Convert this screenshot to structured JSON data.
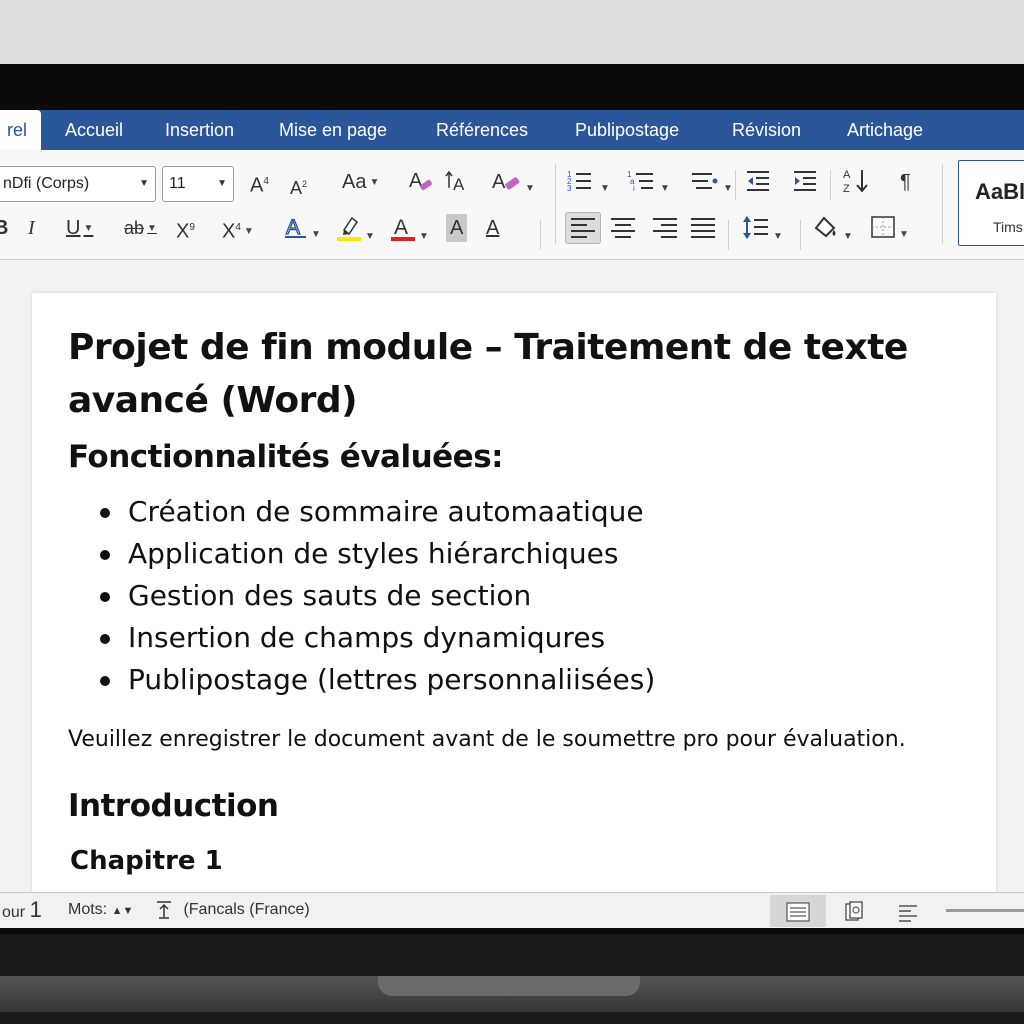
{
  "ribbon_tabs": [
    {
      "label": "rel"
    },
    {
      "label": "Accueil"
    },
    {
      "label": "Insertion"
    },
    {
      "label": "Mise en page"
    },
    {
      "label": "Références"
    },
    {
      "label": "Publipostage"
    },
    {
      "label": "Révision"
    },
    {
      "label": "Artichage"
    }
  ],
  "ribbon": {
    "font_name": "nDfi (Corps)",
    "font_size": "11",
    "grow_font": "A",
    "grow_font_sup": "4",
    "shrink_font": "A",
    "shrink_font_sup": "2",
    "change_case": "Aa",
    "bold": "B",
    "italic": "I",
    "underline": "U",
    "strikethrough": "ab",
    "subscript": "X",
    "subscript_sub": "9",
    "superscript": "X",
    "superscript_sup": "4",
    "text_effects": "A",
    "highlight_color": "#ffe600",
    "font_color_letter": "A",
    "font_color": "#e02020",
    "shading_letter": "A",
    "char_border_letter": "A",
    "sort_label": "A Z",
    "pilcrow": "¶",
    "style_sample": "AaBl",
    "style_name": "Tims"
  },
  "document": {
    "title": "Projet de fin module – Traitement de texte avancé (Word)",
    "features_heading": "Fonctionnalités évaluées:",
    "features": [
      "Création de sommaire automaatique",
      "Application de styles hiérarchiques",
      "Gestion des sauts de section",
      "Insertion de champs dynamiqures",
      "Publipostage (lettres personnaliisées)"
    ],
    "instruction": "Veuillez enregistrer le document avant de le soumettre pro pour évaluation.",
    "heading_intro": "Introduction",
    "heading_chapter": "Chapitre 1"
  },
  "status": {
    "page_label": "our",
    "page_number": "1",
    "words_label": "Mots:",
    "language": "(Fancals (France)"
  }
}
